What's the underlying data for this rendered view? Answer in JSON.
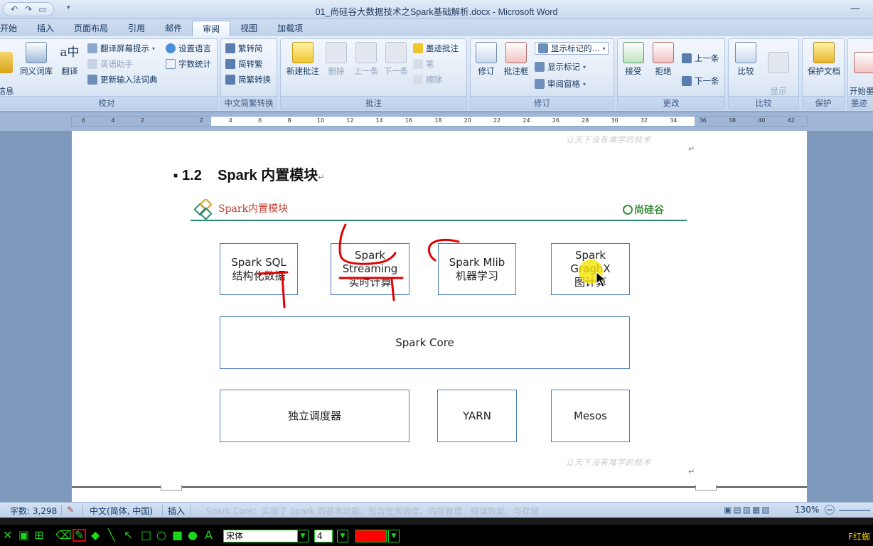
{
  "window": {
    "title": "01_尚硅谷大数据技术之Spark基础解析.docx - Microsoft Word",
    "minimize_glyph": "—"
  },
  "tabs": [
    "开始",
    "插入",
    "页面布局",
    "引用",
    "邮件",
    "审阅",
    "视图",
    "加载项"
  ],
  "active_tab": "审阅",
  "ribbon": {
    "proofing": {
      "label": "校对",
      "info_button": "信息\n检索",
      "thesaurus": "同义词库",
      "translate": "翻译",
      "translate_tip": "翻译屏幕提示",
      "english_assistant": "英语助手",
      "update_ime": "更新输入法词典",
      "set_language": "设置语言",
      "word_count": "字数统计"
    },
    "chinese_conversion": {
      "label": "中文简繁转换",
      "to_simplified": "繁转简",
      "to_traditional": "简转繁",
      "convert": "简繁转换"
    },
    "comments": {
      "label": "批注",
      "new_comment": "新建批注",
      "delete": "删除",
      "previous": "上一条",
      "next": "下一条",
      "ink_comment": "墨迹批注",
      "pen": "笔",
      "erase": "擦除"
    },
    "tracking": {
      "label": "修订",
      "track_changes": "修订",
      "balloons": "批注框",
      "display_for_review": "显示标记的...",
      "show_markup": "显示标记",
      "reviewing_pane": "审阅窗格"
    },
    "changes": {
      "label": "更改",
      "accept": "接受",
      "reject": "拒绝",
      "previous": "上一条",
      "next": "下一条"
    },
    "compare": {
      "label": "比较",
      "compare": "比较",
      "show_source": "显示\n源文档"
    },
    "protect": {
      "label": "保护",
      "protect_document": "保护文档"
    },
    "ink": {
      "label": "墨迹",
      "start_inking": "开始墨\n迹书写"
    }
  },
  "ruler": {
    "numbers": [
      "6",
      "4",
      "2",
      "",
      "2",
      "4",
      "6",
      "8",
      "10",
      "12",
      "14",
      "16",
      "18",
      "20",
      "22",
      "24",
      "26",
      "28",
      "30",
      "32",
      "34",
      "36",
      "38",
      "40",
      "42"
    ]
  },
  "document": {
    "watermark": "让天下没有难学的技术",
    "heading_number": "1.2",
    "heading_text": "Spark 内置模块",
    "return_mark": "↵",
    "figure": {
      "title": "Spark内置模块",
      "brand": "尚硅谷",
      "modules_row1": [
        {
          "line1": "Spark SQL",
          "line2": "结构化数据"
        },
        {
          "line1": "Spark",
          "line2": "Streaming",
          "line3": "实时计算"
        },
        {
          "line1": "Spark Mlib",
          "line2": "机器学习"
        },
        {
          "line1": "Spark",
          "line2": "GraghX",
          "line3": "图计算"
        }
      ],
      "core": "Spark Core",
      "schedulers": [
        "独立调度器",
        "YARN",
        "Mesos"
      ]
    },
    "annotation_color": "#e00000",
    "highlight_color": "#f5e400"
  },
  "statusbar": {
    "word_count": "字数: 3,298",
    "language": "中文(简体, 中国)",
    "mode": "插入",
    "zoom": "130%",
    "behind_text": "Spark Core：实现了 Spark 的基本功能，包含任务调度、内存管理、错误恢复、与存储"
  },
  "drawbar": {
    "font": "宋体",
    "size": "4",
    "pen_color": "#ff0000",
    "right_label": "F红蜘"
  }
}
